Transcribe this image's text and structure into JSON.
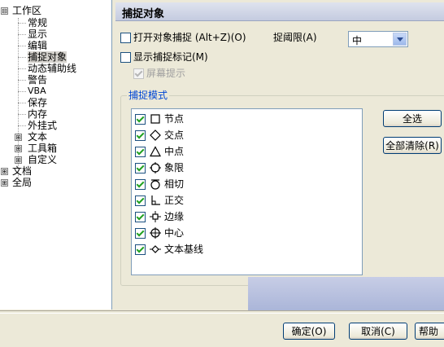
{
  "tree": {
    "items": [
      {
        "label": "工作区",
        "expander": "⊟"
      },
      {
        "label": "常规"
      },
      {
        "label": "显示"
      },
      {
        "label": "编辑"
      },
      {
        "label": "捕捉对象"
      },
      {
        "label": "动态辅助线"
      },
      {
        "label": "警告"
      },
      {
        "label": "VBA"
      },
      {
        "label": "保存"
      },
      {
        "label": "内存"
      },
      {
        "label": "外挂式"
      },
      {
        "label": "文本",
        "expander": "⊞"
      },
      {
        "label": "工具箱",
        "expander": "⊞"
      },
      {
        "label": "自定义",
        "expander": "⊞"
      },
      {
        "label": "文档",
        "expander": "⊞"
      },
      {
        "label": "全局",
        "expander": "⊞"
      }
    ]
  },
  "header": {
    "title": "捕捉对象"
  },
  "options": {
    "snap_on": {
      "label": "打开对象捕捉 (Alt+Z)(O)",
      "checked": false
    },
    "threshold_label": "捉阈限(A)",
    "threshold_value": "中",
    "show_marker": {
      "label": "显示捕捉标记(M)",
      "checked": false
    },
    "screen_tip": {
      "label": "屏幕提示",
      "checked": true
    }
  },
  "modes": {
    "group_title": "捕捉模式",
    "items": [
      {
        "label": "节点",
        "icon": "square-icon",
        "checked": true
      },
      {
        "label": "交点",
        "icon": "diamond-icon",
        "checked": true
      },
      {
        "label": "中点",
        "icon": "triangle-icon",
        "checked": true
      },
      {
        "label": "象限",
        "icon": "quadrant-circle-icon",
        "checked": true
      },
      {
        "label": "相切",
        "icon": "tangent-icon",
        "checked": true
      },
      {
        "label": "正交",
        "icon": "perpendicular-icon",
        "checked": true
      },
      {
        "label": "边缘",
        "icon": "edge-icon",
        "checked": true
      },
      {
        "label": "中心",
        "icon": "center-icon",
        "checked": true
      },
      {
        "label": "文本基线",
        "icon": "baseline-icon",
        "checked": true
      }
    ],
    "select_all": "全选",
    "clear_all": "全部清除(R)"
  },
  "footer": {
    "ok": "确定(O)",
    "cancel": "取消(C)",
    "help": "帮助"
  }
}
